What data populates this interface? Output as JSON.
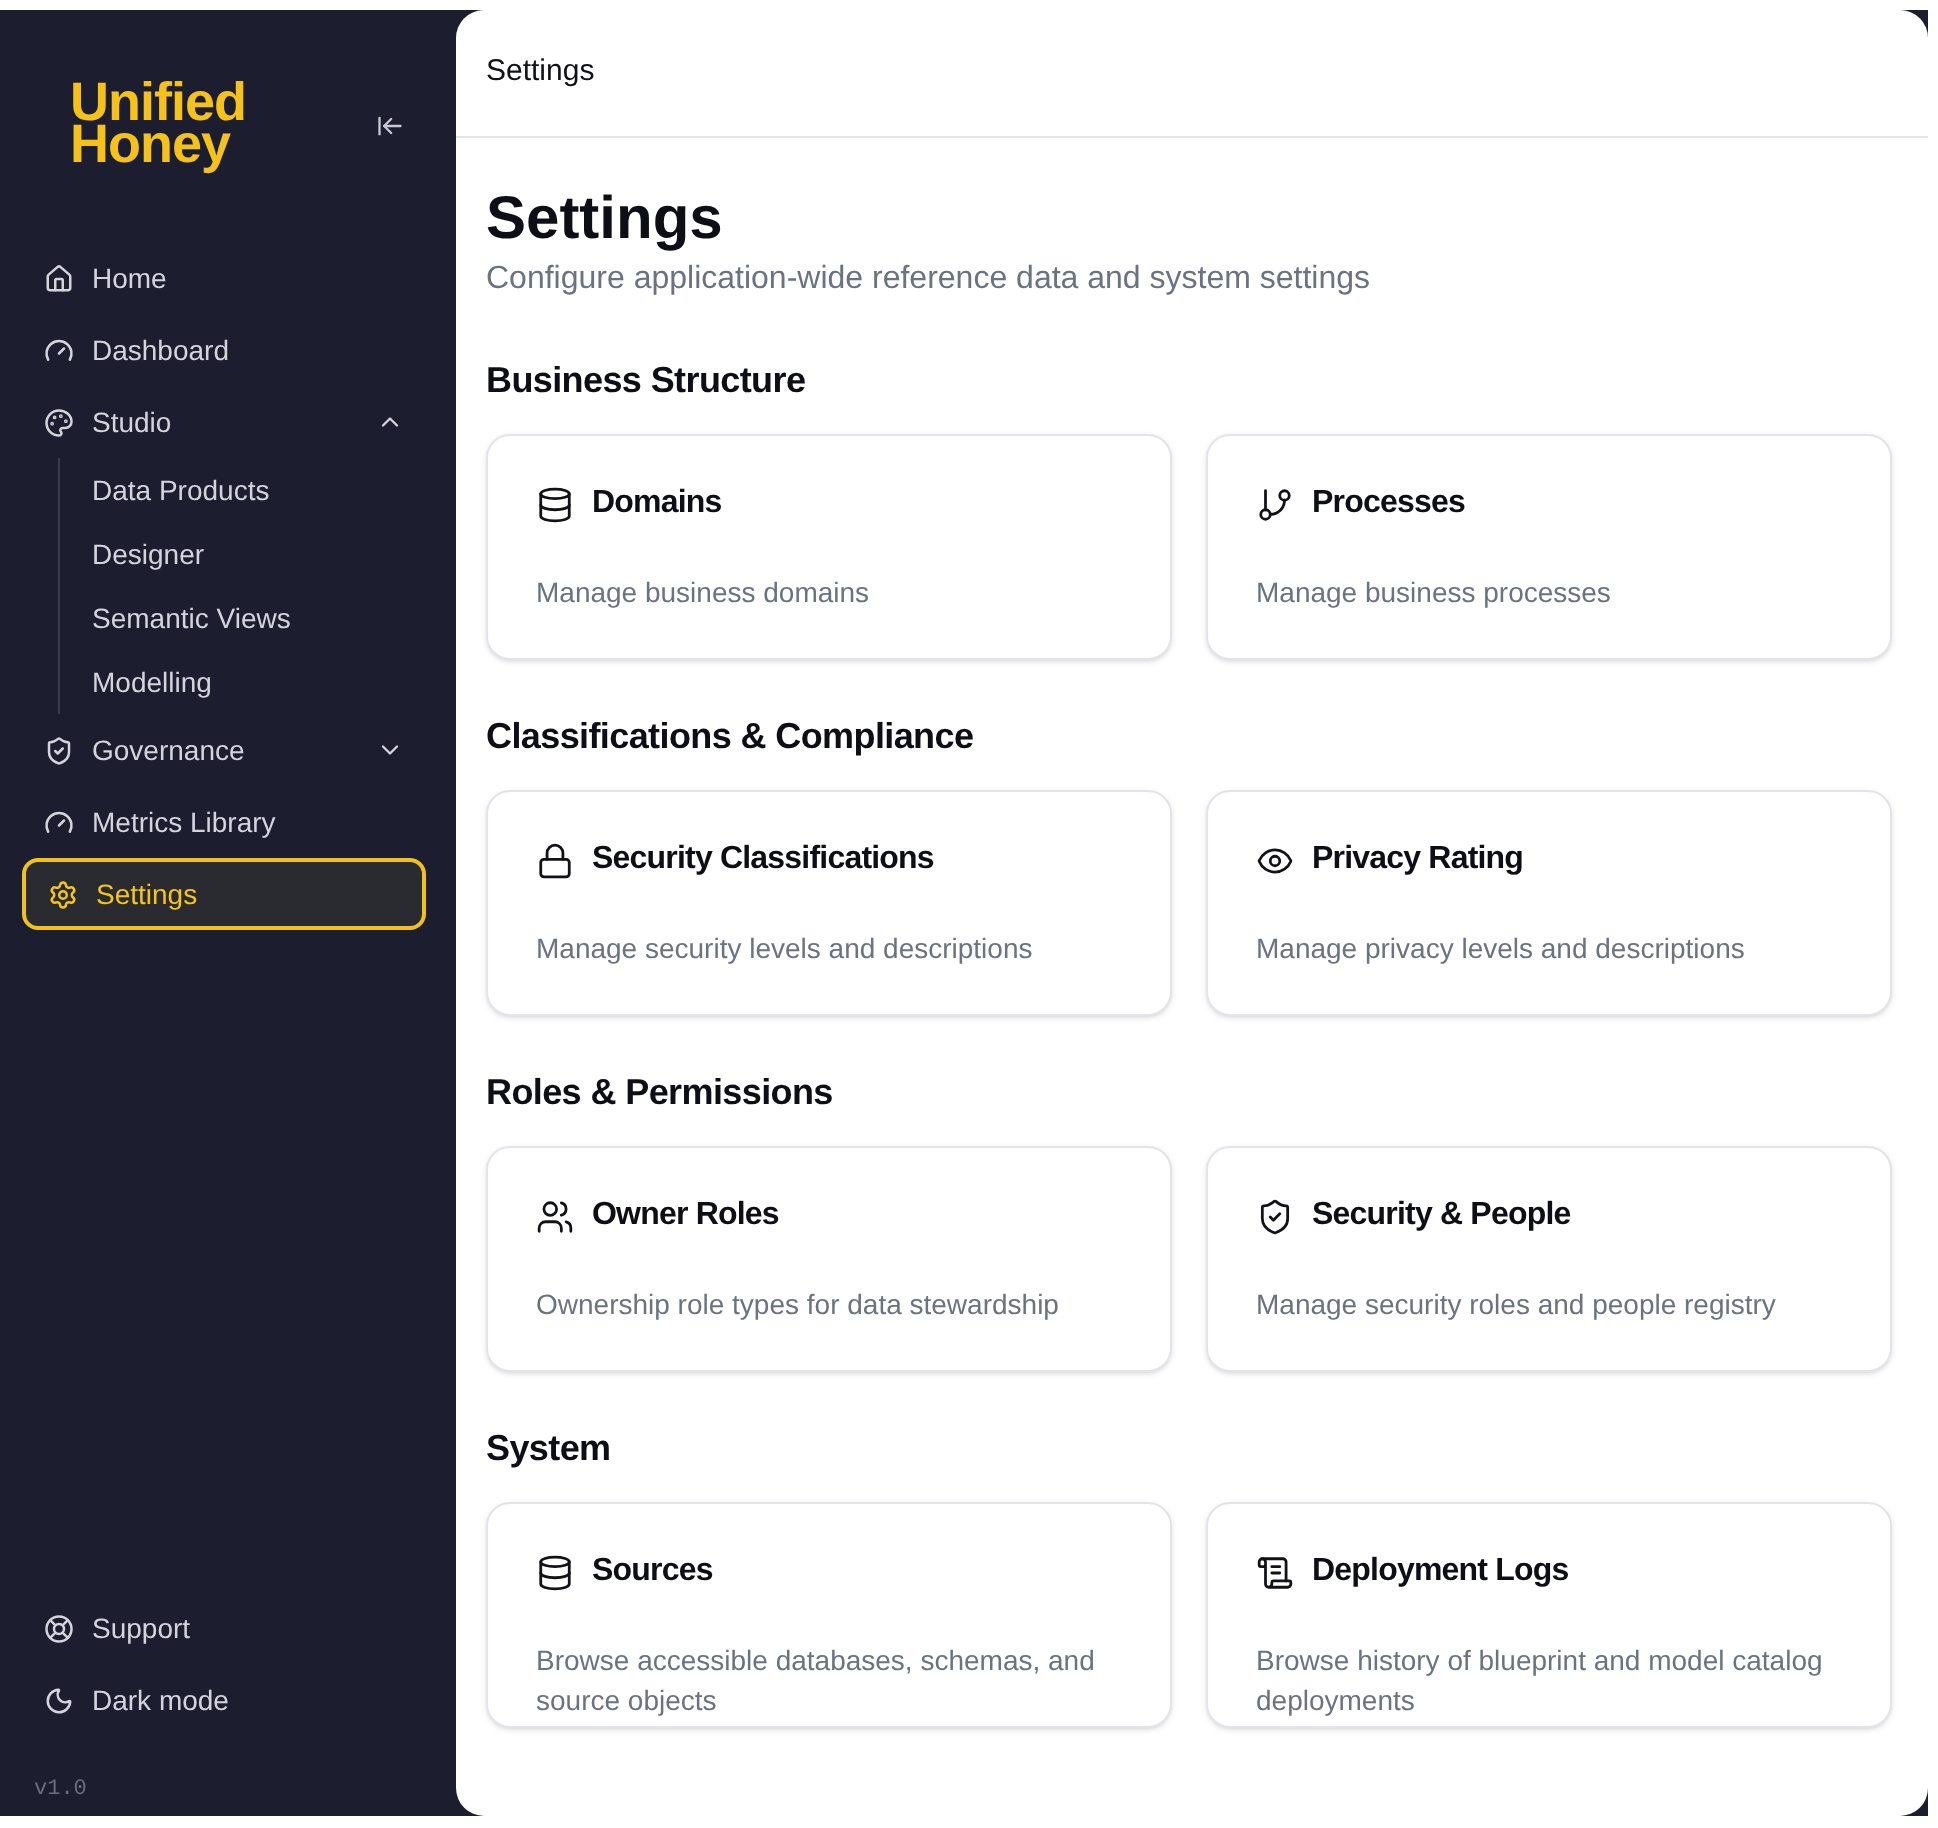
{
  "sidebar": {
    "logo_lines": [
      "Unified",
      "Honey"
    ],
    "items": [
      {
        "kind": "link",
        "label": "Home",
        "selected": false
      },
      {
        "kind": "link",
        "label": "Dashboard",
        "selected": false
      },
      {
        "kind": "group",
        "label": "Studio",
        "selected": false,
        "expanded": true,
        "children": [
          {
            "label": "Data Products",
            "selected": false
          },
          {
            "label": "Designer",
            "selected": false
          },
          {
            "label": "Semantic Views",
            "selected": false
          },
          {
            "label": "Modelling",
            "selected": false
          }
        ]
      },
      {
        "kind": "group",
        "label": "Governance",
        "selected": false,
        "expanded": false
      },
      {
        "kind": "link",
        "label": "Metrics Library",
        "selected": false
      },
      {
        "kind": "link",
        "label": "Settings",
        "selected": true
      }
    ],
    "footer_items": [
      {
        "label": "Support"
      },
      {
        "label": "Dark mode"
      }
    ],
    "version": "v1.0"
  },
  "header": {
    "title": "Settings"
  },
  "page": {
    "title": "Settings",
    "subtitle": "Configure application-wide reference data and system settings"
  },
  "sections": [
    {
      "title": "Business Structure",
      "cards": [
        {
          "title": "Domains",
          "description": "Manage business domains"
        },
        {
          "title": "Processes",
          "description": "Manage business processes"
        }
      ]
    },
    {
      "title": "Classifications & Compliance",
      "cards": [
        {
          "title": "Security Classifications",
          "description": "Manage security levels and descriptions"
        },
        {
          "title": "Privacy Rating",
          "description": "Manage privacy levels and descriptions"
        }
      ]
    },
    {
      "title": "Roles & Permissions",
      "cards": [
        {
          "title": "Owner Roles",
          "description": "Ownership role types for data stewardship"
        },
        {
          "title": "Security & People",
          "description": "Manage security roles and people registry"
        }
      ]
    },
    {
      "title": "System",
      "cards": [
        {
          "title": "Sources",
          "description": "Browse accessible databases, schemas, and source objects"
        },
        {
          "title": "Deployment Logs",
          "description": "Browse history of blueprint and model catalog deployments"
        }
      ]
    }
  ]
}
